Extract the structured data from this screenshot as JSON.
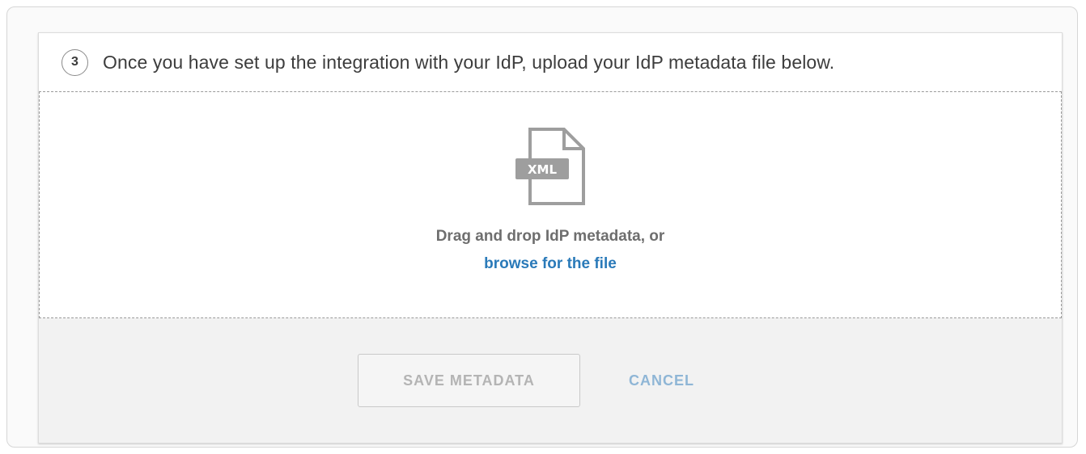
{
  "step": {
    "number": "3",
    "instruction": "Once you have set up the integration with your IdP, upload your IdP metadata file below."
  },
  "dropzone": {
    "icon": "xml-file-icon",
    "icon_label": "XML",
    "prompt": "Drag and drop IdP metadata, or",
    "browse_link": "browse for the file"
  },
  "actions": {
    "save_label": "SAVE METADATA",
    "cancel_label": "CANCEL"
  },
  "colors": {
    "link": "#2a7ab9",
    "cancel": "#8fb6d6",
    "footer_bg": "#f2f2f2",
    "disabled_text": "#b4b4b4"
  }
}
